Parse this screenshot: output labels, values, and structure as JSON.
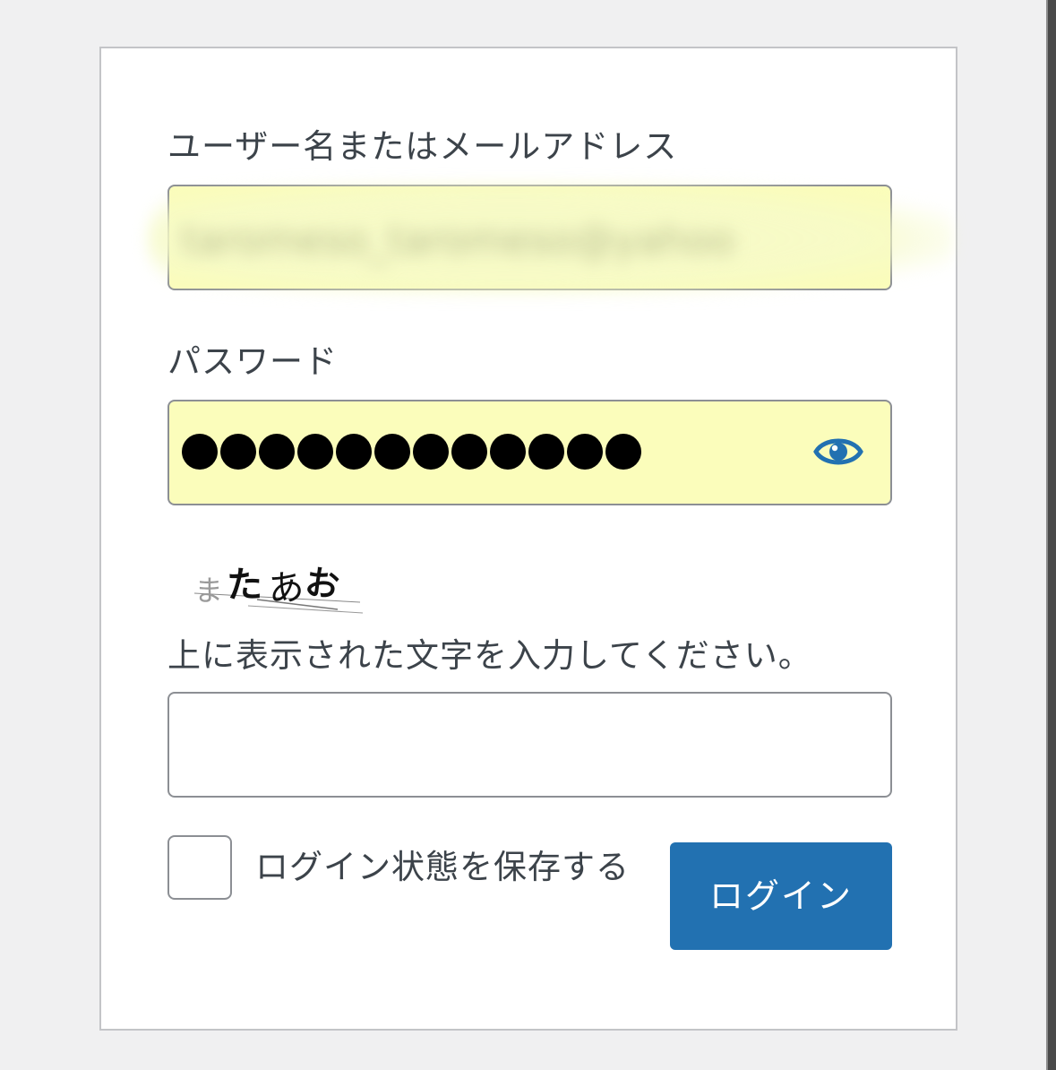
{
  "form": {
    "username_label": "ユーザー名またはメールアドレス",
    "username_value": "taromeso_taromeso@yahoo",
    "password_label": "パスワード",
    "password_mask_count": 12,
    "show_password_icon": "eye-icon",
    "captcha_text": "またあお",
    "captcha_prompt": "上に表示された文字を入力してください。",
    "captcha_value": "",
    "remember_label": "ログイン状態を保存する",
    "remember_checked": false,
    "submit_label": "ログイン"
  },
  "colors": {
    "page_background": "#f0f0f1",
    "card_background": "#ffffff",
    "autofill_background": "#fbfdbb",
    "primary_button": "#2271b1",
    "eye_icon": "#2271b1"
  }
}
